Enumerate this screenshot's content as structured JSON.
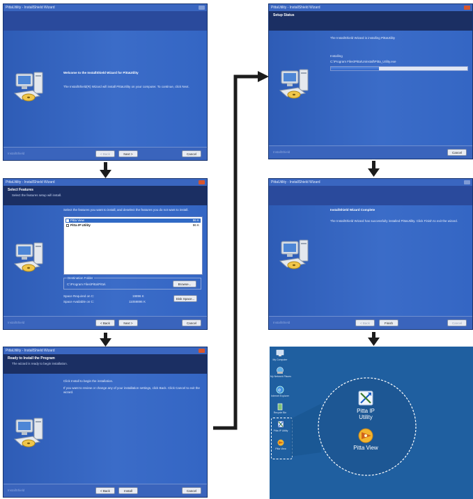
{
  "window_title": "PittaUtility - InstallShield Wizard",
  "installshield_label": "InstallShield",
  "buttons": {
    "back": "< Back",
    "next": "Next >",
    "cancel": "Cancel",
    "install": "Install",
    "finish": "Finish",
    "browse": "Browse...",
    "disk_space": "Disk Space..."
  },
  "welcome": {
    "heading": "Welcome to the InstallShield Wizard for PittaUtility",
    "desc": "The InstallShield(R) Wizard will install PittaUtility on your computer. To continue, click Next."
  },
  "select_features": {
    "header": "Select Features",
    "sub": "Select the features setup will install.",
    "instruction": "Select the features you want to install, and deselect the features you do not want to install.",
    "features": [
      {
        "name": "Pitta View",
        "size": "96 K"
      },
      {
        "name": "Pitta IP Utility",
        "size": "96 K"
      }
    ],
    "dest_label": "Destination Folder",
    "dest_path": "C:\\Program Files\\Pitta\\Pitta\\",
    "space_required_label": "Space Required on C:",
    "space_required": "19896 K",
    "space_available_label": "Space Available on C:",
    "space_available": "11059896 K"
  },
  "ready": {
    "header": "Ready to Install the Program",
    "sub": "The wizard is ready to begin installation.",
    "line1": "Click Install to begin the installation.",
    "line2": "If you want to review or change any of your installation settings, click Back. Click Cancel to exit the",
    "line3": "wizard."
  },
  "setup_status": {
    "header": "Setup Status",
    "desc": "The InstallShield Wizard is installing PittaUtility",
    "installing_label": "Installing",
    "path": "C:\\Program Files\\Pitta\\Uninstall\\Pitta_Utility.exe",
    "progress": 0.35
  },
  "complete": {
    "heading": "InstallShield Wizard Complete",
    "desc": "The InstallShield Wizard has successfully installed PittaUtility. Click Finish to exit the wizard."
  },
  "desktop": {
    "icons": [
      "My Computer",
      "My Network Places",
      "Internet Explorer",
      "Recycle Bin",
      "Pitta IP Utility",
      "Pitta View"
    ],
    "zoom_items": [
      {
        "label": "Pitta IP Utility",
        "icon": "pitta-ip-utility-icon"
      },
      {
        "label": "Pitta View",
        "icon": "pitta-view-icon"
      }
    ]
  },
  "colors": {
    "wizard_blue": "#2f5bb2",
    "header_navy": "#1b2f63",
    "desktop_blue": "#1f5fa0",
    "close_red": "#d8562c"
  }
}
